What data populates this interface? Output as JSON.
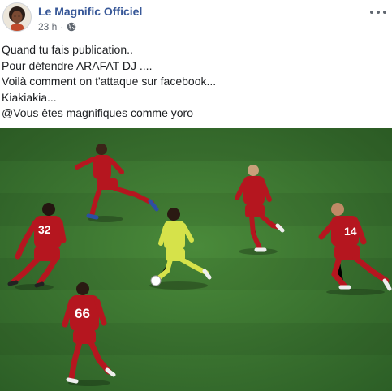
{
  "post": {
    "author": "Le Magnific Officiel",
    "time": "23 h",
    "separator": "·",
    "privacy_icon": "globe-icon",
    "more_icon": "more-dots-icon",
    "lines": [
      "Quand tu fais publication..",
      "Pour défendre ARAFAT DJ ....",
      "Voilà comment on t'attaque sur facebook...",
      "Kiakiakia...",
      "@Vous êtes magnifiques comme yoro"
    ]
  },
  "photo": {
    "jersey_numbers": [
      "32",
      "66",
      "14"
    ]
  },
  "colors": {
    "link": "#385898",
    "meta": "#606770",
    "pitch": "#3f7a33",
    "red_kit": "#b5161f",
    "yellow_kit": "#d6e24a"
  }
}
